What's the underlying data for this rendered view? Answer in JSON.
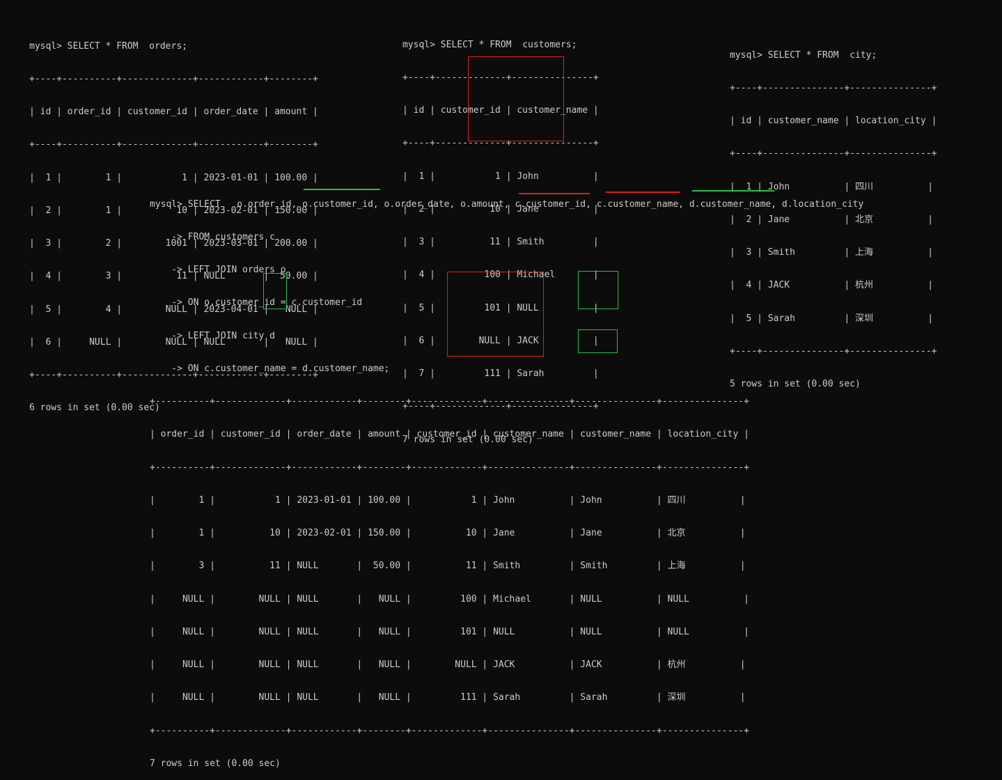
{
  "orders_block": {
    "lines": [
      "mysql> SELECT * FROM  orders;",
      "+----+----------+-------------+------------+--------+",
      "| id | order_id | customer_id | order_date | amount |",
      "+----+----------+-------------+------------+--------+",
      "|  1 |        1 |           1 | 2023-01-01 | 100.00 |",
      "|  2 |        1 |          10 | 2023-02-01 | 150.00 |",
      "|  3 |        2 |        1001 | 2023-03-01 | 200.00 |",
      "|  4 |        3 |          11 | NULL       |  50.00 |",
      "|  5 |        4 |        NULL | 2023-04-01 |   NULL |",
      "|  6 |     NULL |        NULL | NULL       |   NULL |",
      "+----+----------+-------------+------------+--------+",
      "6 rows in set (0.00 sec)"
    ]
  },
  "customers_block": {
    "lines": [
      "mysql> SELECT * FROM  customers;",
      "+----+-------------+---------------+",
      "| id | customer_id | customer_name |",
      "+----+-------------+---------------+",
      "|  1 |           1 | John          |",
      "|  2 |          10 | Jane          |",
      "|  3 |          11 | Smith         |",
      "|  4 |         100 | Michael       |",
      "|  5 |         101 | NULL          |",
      "|  6 |        NULL | JACK          |",
      "|  7 |         111 | Sarah         |",
      "+----+-------------+---------------+",
      "7 rows in set (0.00 sec)"
    ]
  },
  "city_block": {
    "lines": [
      "mysql> SELECT * FROM  city;",
      "+----+---------------+---------------+",
      "| id | customer_name | location_city |",
      "+----+---------------+---------------+",
      "|  1 | John          | 四川          |",
      "|  2 | Jane          | 北京          |",
      "|  3 | Smith         | 上海          |",
      "|  4 | JACK          | 杭州          |",
      "|  5 | Sarah         | 深圳          |",
      "+----+---------------+---------------+",
      "5 rows in set (0.00 sec)"
    ]
  },
  "join_block": {
    "lines": [
      "mysql> SELECT   o.order_id, o.customer_id, o.order_date, o.amount, c.customer_id, c.customer_name, d.customer_name, d.location_city",
      "    -> FROM customers c",
      "    -> LEFT JOIN orders o",
      "    -> ON o.customer_id = c.customer_id",
      "    -> LEFT JOIN city d",
      "    -> ON c.customer_name = d.customer_name;",
      "+----------+-------------+------------+--------+-------------+---------------+---------------+---------------+",
      "| order_id | customer_id | order_date | amount | customer_id | customer_name | customer_name | location_city |",
      "+----------+-------------+------------+--------+-------------+---------------+---------------+---------------+",
      "|        1 |           1 | 2023-01-01 | 100.00 |           1 | John          | John          | 四川          |",
      "|        1 |          10 | 2023-02-01 | 150.00 |          10 | Jane          | Jane          | 北京          |",
      "|        3 |          11 | NULL       |  50.00 |          11 | Smith         | Smith         | 上海          |",
      "|     NULL |        NULL | NULL       |   NULL |         100 | Michael       | NULL          | NULL          |",
      "|     NULL |        NULL | NULL       |   NULL |         101 | NULL          | NULL          | NULL          |",
      "|     NULL |        NULL | NULL       |   NULL |        NULL | JACK          | JACK          | 杭州          |",
      "|     NULL |        NULL | NULL       |   NULL |         111 | Sarah         | Sarah         | 深圳          |",
      "+----------+-------------+------------+--------+-------------+---------------+---------------+---------------+",
      "7 rows in set (0.00 sec)"
    ]
  },
  "colors": {
    "background": "#0c0c0c",
    "text": "#cccccc",
    "highlight_red": "#e0201d",
    "highlight_green": "#2fbb4a"
  }
}
